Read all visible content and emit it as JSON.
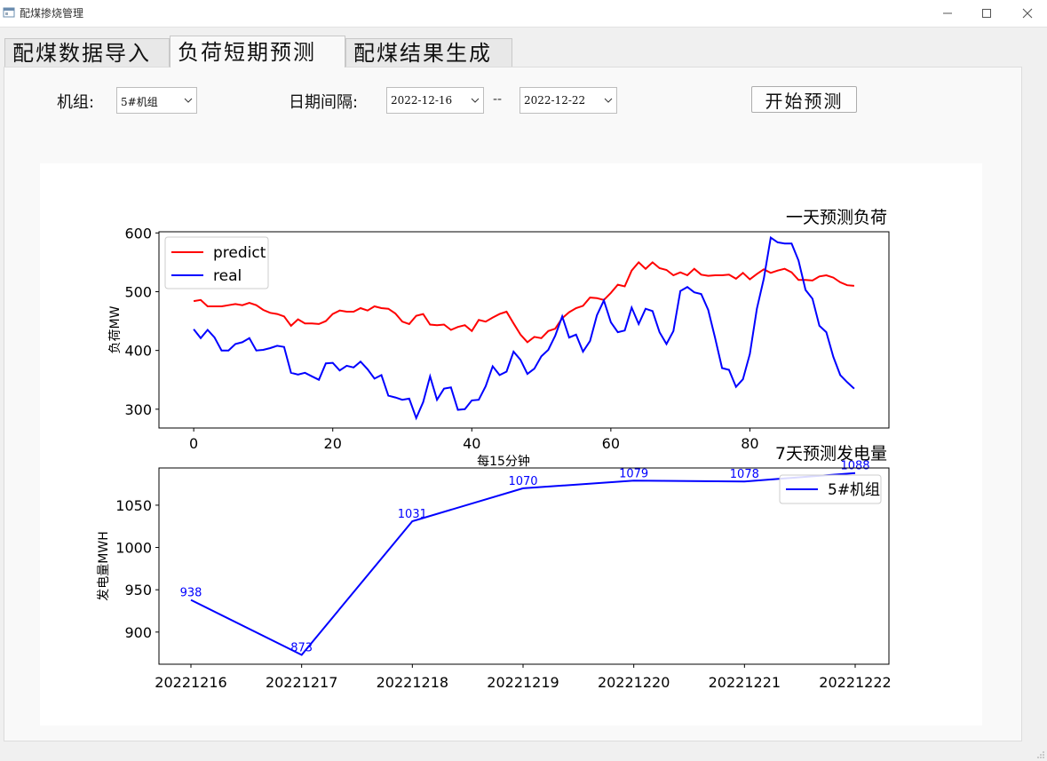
{
  "window": {
    "title": "配煤掺烧管理",
    "minimize_icon": "minimize-icon",
    "maximize_icon": "maximize-icon",
    "close_icon": "close-icon"
  },
  "tabs": [
    {
      "label": "配煤数据导入",
      "active": false
    },
    {
      "label": "负荷短期预测",
      "active": true
    },
    {
      "label": "配煤结果生成",
      "active": false
    }
  ],
  "controls": {
    "unit_label": "机组:",
    "unit_value": "5#机组",
    "date_label": "日期间隔:",
    "start_date": "2022-12-16",
    "separator": "--",
    "end_date": "2022-12-22",
    "start_button": "开始预测"
  },
  "colors": {
    "predict": "#ff0000",
    "real": "#0000ff",
    "energy": "#0000ff",
    "axes": "#000000"
  },
  "chart_data": [
    {
      "type": "line",
      "title": "一天预测负荷",
      "xlabel": "每15分钟",
      "ylabel": "负荷MW",
      "xlim": [
        -5,
        100
      ],
      "ylim": [
        268,
        602
      ],
      "xticks": [
        0,
        20,
        40,
        60,
        80
      ],
      "yticks": [
        300,
        400,
        500,
        600
      ],
      "legend_position": "top-left",
      "series": [
        {
          "name": "predict",
          "color": "#ff0000",
          "x": [
            0,
            1,
            2,
            3,
            4,
            5,
            6,
            7,
            8,
            9,
            10,
            11,
            12,
            13,
            14,
            15,
            16,
            17,
            18,
            19,
            20,
            21,
            22,
            23,
            24,
            25,
            26,
            27,
            28,
            29,
            30,
            31,
            32,
            33,
            34,
            35,
            36,
            37,
            38,
            39,
            40,
            41,
            42,
            43,
            44,
            45,
            46,
            47,
            48,
            49,
            50,
            51,
            52,
            53,
            54,
            55,
            56,
            57,
            58,
            59,
            60,
            61,
            62,
            63,
            64,
            65,
            66,
            67,
            68,
            69,
            70,
            71,
            72,
            73,
            74,
            75,
            76,
            77,
            78,
            79,
            80,
            81,
            82,
            83,
            84,
            85,
            86,
            87,
            88,
            89,
            90,
            91,
            92,
            93,
            94,
            95
          ],
          "values": [
            484,
            486,
            475,
            475,
            475,
            477,
            479,
            477,
            481,
            477,
            469,
            464,
            462,
            458,
            442,
            453,
            446,
            446,
            445,
            450,
            462,
            468,
            466,
            466,
            472,
            468,
            475,
            472,
            471,
            463,
            449,
            445,
            459,
            462,
            444,
            443,
            444,
            435,
            440,
            443,
            433,
            452,
            449,
            456,
            462,
            466,
            446,
            427,
            414,
            423,
            421,
            433,
            437,
            455,
            465,
            472,
            476,
            490,
            489,
            486,
            498,
            512,
            509,
            536,
            550,
            539,
            550,
            540,
            537,
            528,
            533,
            528,
            539,
            529,
            527,
            528,
            528,
            529,
            522,
            532,
            521,
            530,
            538,
            532,
            536,
            539,
            533,
            520,
            520,
            519,
            526,
            528,
            524,
            516,
            511,
            510
          ]
        },
        {
          "name": "real",
          "color": "#0000ff",
          "x": [
            0,
            1,
            2,
            3,
            4,
            5,
            6,
            7,
            8,
            9,
            10,
            11,
            12,
            13,
            14,
            15,
            16,
            17,
            18,
            19,
            20,
            21,
            22,
            23,
            24,
            25,
            26,
            27,
            28,
            29,
            30,
            31,
            32,
            33,
            34,
            35,
            36,
            37,
            38,
            39,
            40,
            41,
            42,
            43,
            44,
            45,
            46,
            47,
            48,
            49,
            50,
            51,
            52,
            53,
            54,
            55,
            56,
            57,
            58,
            59,
            60,
            61,
            62,
            63,
            64,
            65,
            66,
            67,
            68,
            69,
            70,
            71,
            72,
            73,
            74,
            75,
            76,
            77,
            78,
            79,
            80,
            81,
            82,
            83,
            84,
            85,
            86,
            87,
            88,
            89,
            90,
            91,
            92,
            93,
            94,
            95
          ],
          "values": [
            436,
            421,
            435,
            422,
            400,
            400,
            411,
            414,
            421,
            400,
            401,
            404,
            408,
            406,
            362,
            359,
            362,
            356,
            350,
            378,
            379,
            366,
            374,
            371,
            381,
            368,
            352,
            358,
            323,
            320,
            316,
            318,
            285,
            312,
            356,
            316,
            335,
            337,
            299,
            300,
            315,
            316,
            339,
            373,
            358,
            364,
            398,
            384,
            360,
            369,
            390,
            401,
            425,
            458,
            422,
            427,
            398,
            416,
            460,
            485,
            448,
            431,
            434,
            473,
            445,
            471,
            467,
            431,
            411,
            433,
            501,
            508,
            499,
            496,
            469,
            421,
            370,
            367,
            338,
            351,
            394,
            471,
            522,
            592,
            584,
            582,
            582,
            553,
            503,
            488,
            442,
            431,
            389,
            358,
            346,
            335
          ]
        }
      ]
    },
    {
      "type": "line",
      "title": "7天预测发电量",
      "xlabel": "",
      "ylabel": "发电量MWH",
      "ylim": [
        862,
        1094
      ],
      "yticks": [
        900,
        950,
        1000,
        1050
      ],
      "legend_position": "top-right",
      "categories": [
        "20221216",
        "20221217",
        "20221218",
        "20221219",
        "20221220",
        "20221221",
        "20221222"
      ],
      "series": [
        {
          "name": "5#机组",
          "color": "#0000ff",
          "values": [
            938,
            873,
            1031,
            1070,
            1079,
            1078,
            1088
          ]
        }
      ]
    }
  ]
}
